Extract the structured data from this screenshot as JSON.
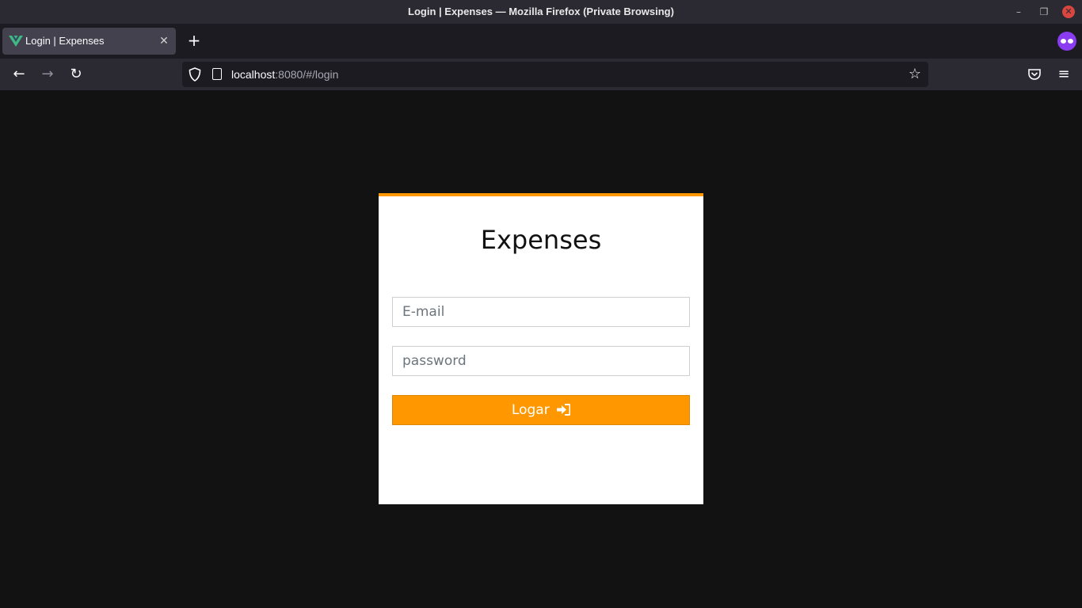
{
  "window": {
    "title": "Login | Expenses — Mozilla Firefox (Private Browsing)",
    "minimize_glyph": "–",
    "maximize_glyph": "❐",
    "close_glyph": "✕"
  },
  "tabs": [
    {
      "label": "Login | Expenses",
      "icon": "vue-logo-icon",
      "active": true
    }
  ],
  "tabbar": {
    "new_tab_glyph": "+",
    "close_glyph": "✕"
  },
  "navbar": {
    "back_glyph": "←",
    "forward_glyph": "→",
    "reload_glyph": "↻",
    "url_host": "localhost",
    "url_rest": ":8080/#/login",
    "star_glyph": "☆",
    "menu_glyph": "≡"
  },
  "login": {
    "title": "Expenses",
    "email_placeholder": "E-mail",
    "password_placeholder": "password",
    "submit_label": "Logar",
    "submit_icon": "sign-in-icon"
  },
  "colors": {
    "accent": "#ff9800",
    "page_background": "#121212",
    "card_background": "#ffffff"
  }
}
